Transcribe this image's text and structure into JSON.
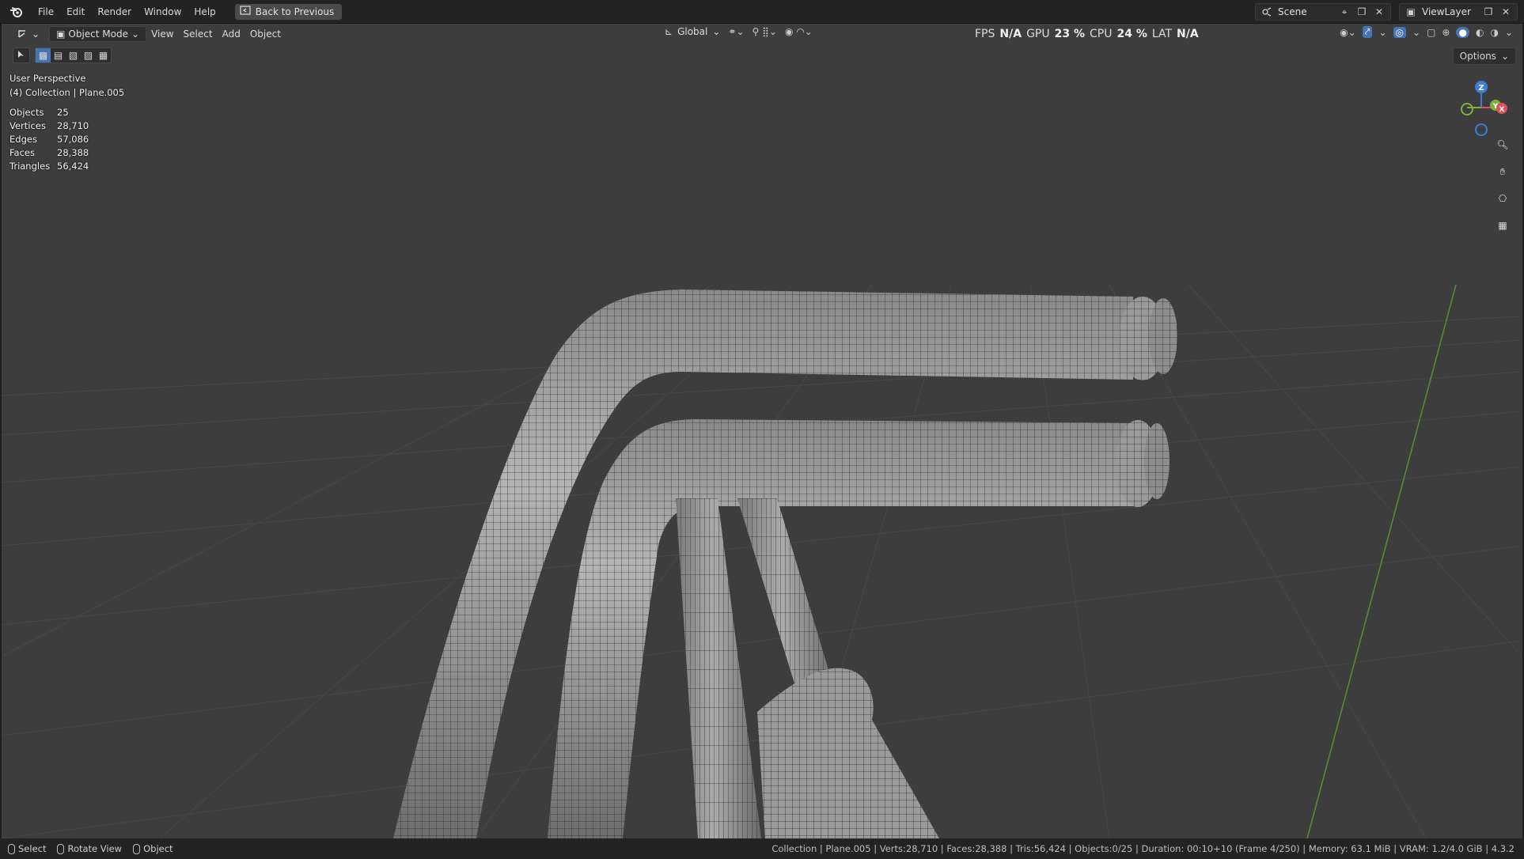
{
  "menubar": {
    "items": [
      "File",
      "Edit",
      "Render",
      "Window",
      "Help"
    ],
    "back_label": "Back to Previous",
    "scene_label": "Scene",
    "viewlayer_label": "ViewLayer"
  },
  "viewport_header": {
    "mode_label": "Object Mode",
    "menus": [
      "View",
      "Select",
      "Add",
      "Object"
    ],
    "orientation_label": "Global",
    "options_label": "Options"
  },
  "perf": {
    "fps_label": "FPS",
    "fps_value": "N/A",
    "gpu_label": "GPU",
    "gpu_value": "23 %",
    "cpu_label": "CPU",
    "cpu_value": "24 %",
    "lat_label": "LAT",
    "lat_value": "N/A"
  },
  "overlay": {
    "view_name": "User Perspective",
    "context": "(4) Collection | Plane.005",
    "stats": [
      {
        "label": "Objects",
        "value": "25"
      },
      {
        "label": "Vertices",
        "value": "28,710"
      },
      {
        "label": "Edges",
        "value": "57,086"
      },
      {
        "label": "Faces",
        "value": "28,388"
      },
      {
        "label": "Triangles",
        "value": "56,424"
      }
    ]
  },
  "gizmo": {
    "z_label": "Z",
    "y_label": "Y",
    "x_label": "X",
    "colors": {
      "x": "#e0505a",
      "y": "#7fb13a",
      "z": "#3b7fd6"
    }
  },
  "statusbar": {
    "select_label": "Select",
    "rotate_label": "Rotate View",
    "object_label": "Object",
    "info": "Collection | Plane.005 | Verts:28,710 | Faces:28,388 | Tris:56,424 | Objects:0/25 | Duration: 00:10+10 (Frame 4/250) | Memory: 63.1 MiB | VRAM: 1.2/4.0 GiB | 4.3.2"
  },
  "icons": [
    "blender-logo-icon",
    "back-icon",
    "scene-icon",
    "viewlayer-icon",
    "editor-type-icon",
    "object-mode-icon",
    "global-orientation-icon",
    "pivot-icon",
    "snap-icon",
    "proportional-icon",
    "visibility-icon",
    "gizmo-icon",
    "overlay-icon",
    "xray-icon",
    "shading-wireframe-icon",
    "shading-solid-icon",
    "shading-material-icon",
    "shading-rendered-icon",
    "zoom-icon",
    "pan-hand-icon",
    "camera-icon",
    "grid-perspective-icon"
  ]
}
